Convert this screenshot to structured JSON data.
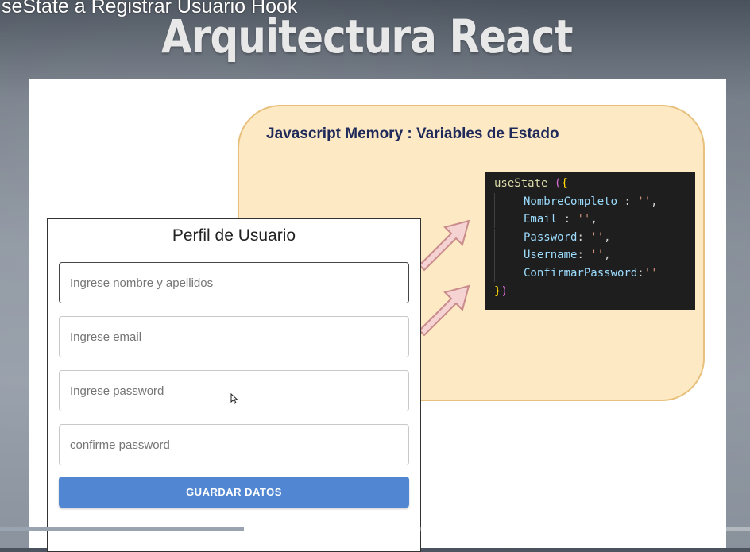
{
  "video": {
    "title": "seState a Registrar Usuario Hook",
    "progress": 0.325
  },
  "slide": {
    "title": "Arquitectura React",
    "memory_title": "Javascript Memory : Variables de Estado"
  },
  "code": {
    "fn": "useState",
    "keys": [
      "NombreCompleto",
      "Email",
      "Password",
      "Username",
      "ConfirmarPassword"
    ]
  },
  "form": {
    "title": "Perfil de Usuario",
    "inputs": [
      {
        "placeholder": "Ingrese nombre y apellidos",
        "value": ""
      },
      {
        "placeholder": "Ingrese email",
        "value": ""
      },
      {
        "placeholder": "Ingrese password",
        "value": ""
      },
      {
        "placeholder": "confirme password",
        "value": ""
      }
    ],
    "button_label": "GUARDAR DATOS"
  },
  "colors": {
    "button": "#5086d2",
    "memory_fill": "#fde9c4",
    "memory_border": "#e8c07c",
    "code_bg": "#1e1e1e"
  }
}
